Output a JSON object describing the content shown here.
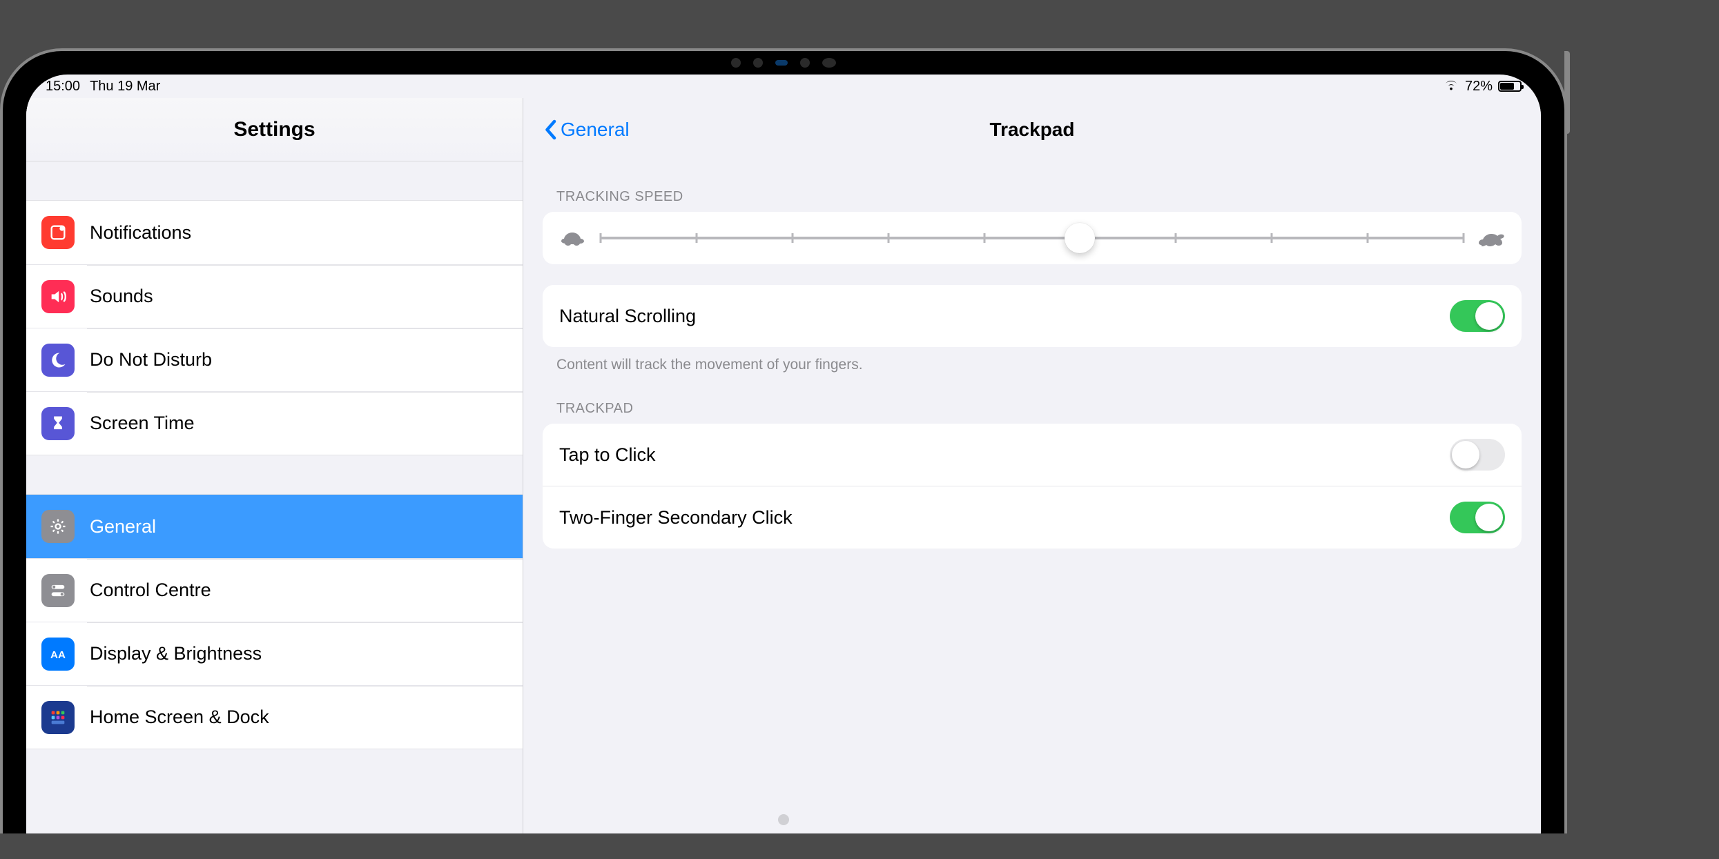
{
  "status_bar": {
    "time": "15:00",
    "date": "Thu 19 Mar",
    "battery_pct": "72%",
    "battery_level": 0.72
  },
  "sidebar": {
    "title": "Settings",
    "groups": [
      [
        {
          "id": "notifications",
          "label": "Notifications",
          "color": "ic-red",
          "icon": "bell"
        },
        {
          "id": "sounds",
          "label": "Sounds",
          "color": "ic-pink",
          "icon": "speaker"
        },
        {
          "id": "dnd",
          "label": "Do Not Disturb",
          "color": "ic-indigo",
          "icon": "moon"
        },
        {
          "id": "screentime",
          "label": "Screen Time",
          "color": "ic-indigo",
          "icon": "hourglass"
        }
      ],
      [
        {
          "id": "general",
          "label": "General",
          "color": "ic-gray",
          "icon": "gear",
          "selected": true
        },
        {
          "id": "controlcentre",
          "label": "Control Centre",
          "color": "ic-gray",
          "icon": "switches"
        },
        {
          "id": "display",
          "label": "Display & Brightness",
          "color": "ic-blue",
          "icon": "aa"
        },
        {
          "id": "homescreen",
          "label": "Home Screen & Dock",
          "color": "ic-darkblue",
          "icon": "grid"
        }
      ]
    ]
  },
  "detail": {
    "back_label": "General",
    "title": "Trackpad",
    "tracking_header": "TRACKING SPEED",
    "tracking": {
      "ticks": 10,
      "value": 5
    },
    "natural_scrolling": {
      "label": "Natural Scrolling",
      "on": true
    },
    "natural_scrolling_note": "Content will track the movement of your fingers.",
    "trackpad_header": "TRACKPAD",
    "tap_to_click": {
      "label": "Tap to Click",
      "on": false
    },
    "two_finger": {
      "label": "Two-Finger Secondary Click",
      "on": true
    }
  }
}
